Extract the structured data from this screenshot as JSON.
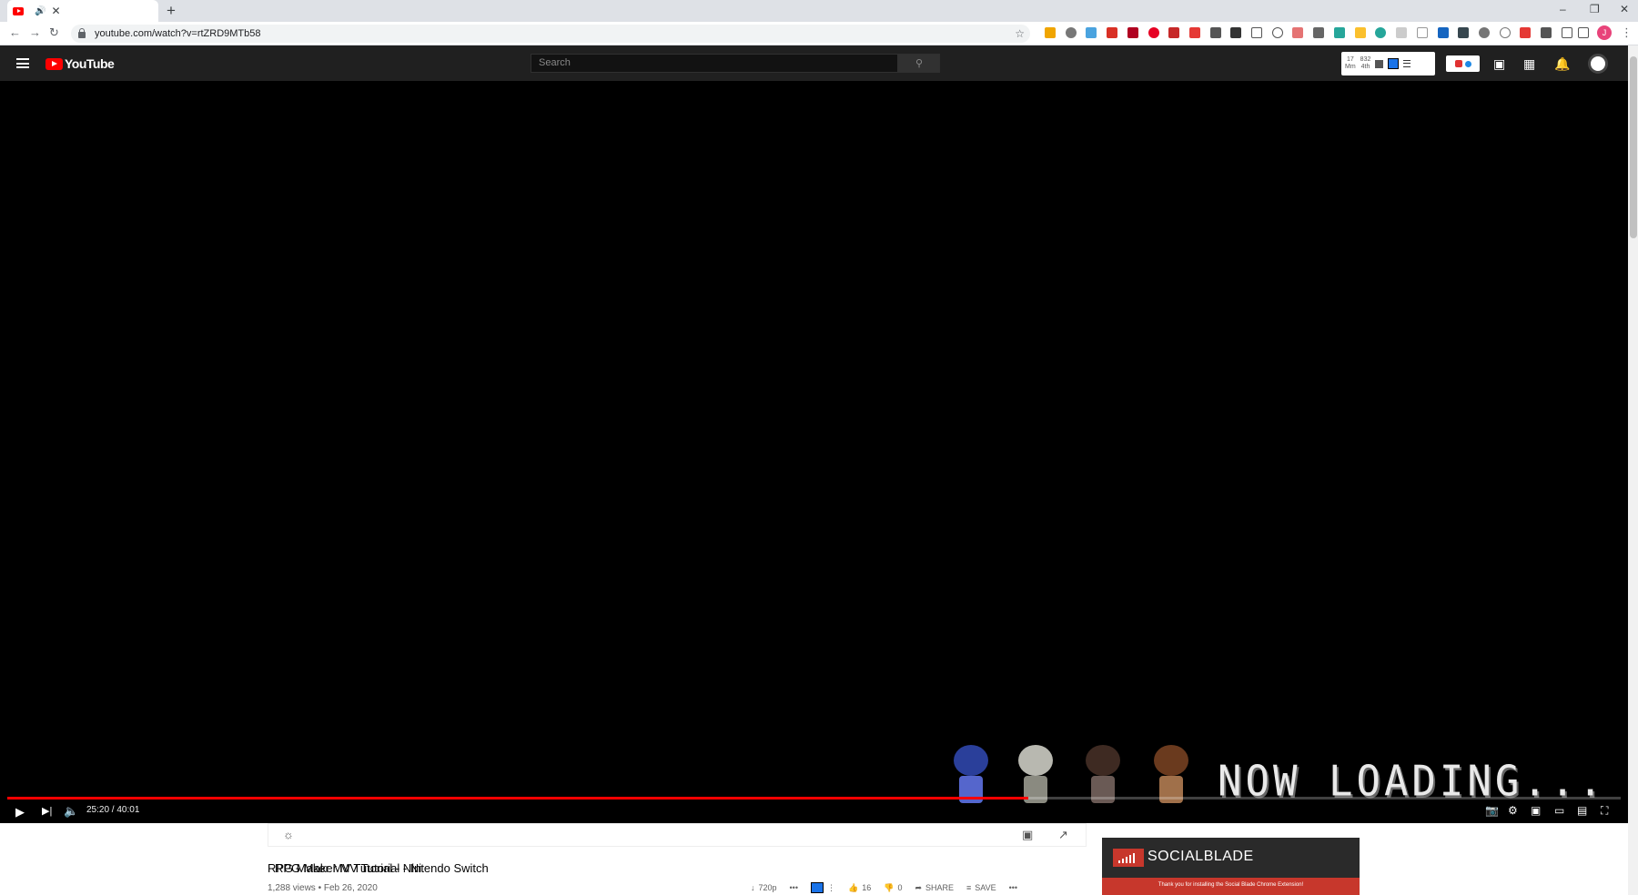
{
  "browser": {
    "tab_title": "RPG Maker MV Tutorial - Ni",
    "url": "youtube.com/watch?v=rtZRD9MTb58",
    "new_tab": "+",
    "profile_initial": "J"
  },
  "youtube": {
    "logo_text": "YouTube",
    "search_placeholder": "Search",
    "stats": {
      "a_top": "17",
      "a_bottom": "Mm",
      "b_top": "832",
      "b_bottom": "4th"
    }
  },
  "player": {
    "time": "25:20 / 40:01",
    "progress": 0.633,
    "overlay_text": "NOW LOADING..."
  },
  "video_info": {
    "title": "RPG Maker MV Tutorial - Nintendo Switch",
    "meta": "1,288 views • Feb 26, 2020",
    "quality": "720p",
    "likes": "16",
    "dislikes": "0",
    "share": "SHARE",
    "save": "SAVE"
  },
  "socialblade": {
    "name": "SOCIALBLADE",
    "banner": "Thank you for installing the Social Blade Chrome Extension!"
  },
  "colors": {
    "accent": "#ff0000",
    "masthead": "#202020",
    "socialblade_red": "#c7372c"
  }
}
